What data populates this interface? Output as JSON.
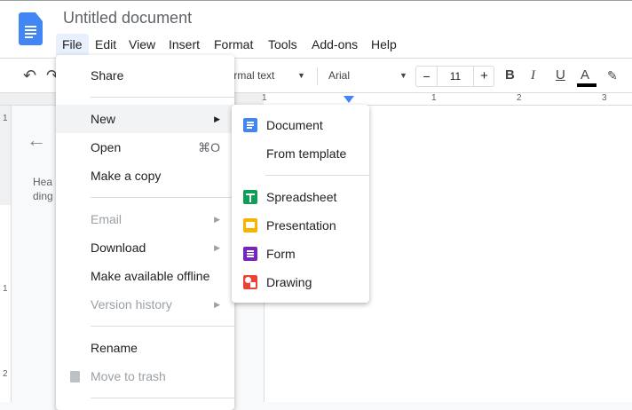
{
  "doc_title": "Untitled document",
  "menubar": [
    "File",
    "Edit",
    "View",
    "Insert",
    "Format",
    "Tools",
    "Add-ons",
    "Help"
  ],
  "toolbar": {
    "style": "Normal text",
    "font": "Arial",
    "font_size": "11",
    "minus": "−",
    "plus": "+",
    "bold": "B",
    "italic": "I",
    "underline": "U",
    "text_color": "A",
    "text_color_value": "#000000"
  },
  "ruler": {
    "h": [
      "1",
      "1",
      "2",
      "3"
    ],
    "v": [
      "1",
      "1",
      "2"
    ]
  },
  "outline": {
    "text": "Headings you add to the document will appear here."
  },
  "file_menu": {
    "share": "Share",
    "new": "New",
    "open": "Open",
    "open_shortcut": "⌘O",
    "copy": "Make a copy",
    "email": "Email",
    "download": "Download",
    "offline": "Make available offline",
    "version": "Version history",
    "rename": "Rename",
    "trash": "Move to trash"
  },
  "new_submenu": {
    "document": "Document",
    "template": "From template",
    "spreadsheet": "Spreadsheet",
    "presentation": "Presentation",
    "form": "Form",
    "drawing": "Drawing"
  },
  "colors": {
    "docs": "#4285f4",
    "sheets": "#0f9d58",
    "slides": "#f4b400",
    "forms": "#7627bb",
    "drawings": "#ea4335"
  }
}
